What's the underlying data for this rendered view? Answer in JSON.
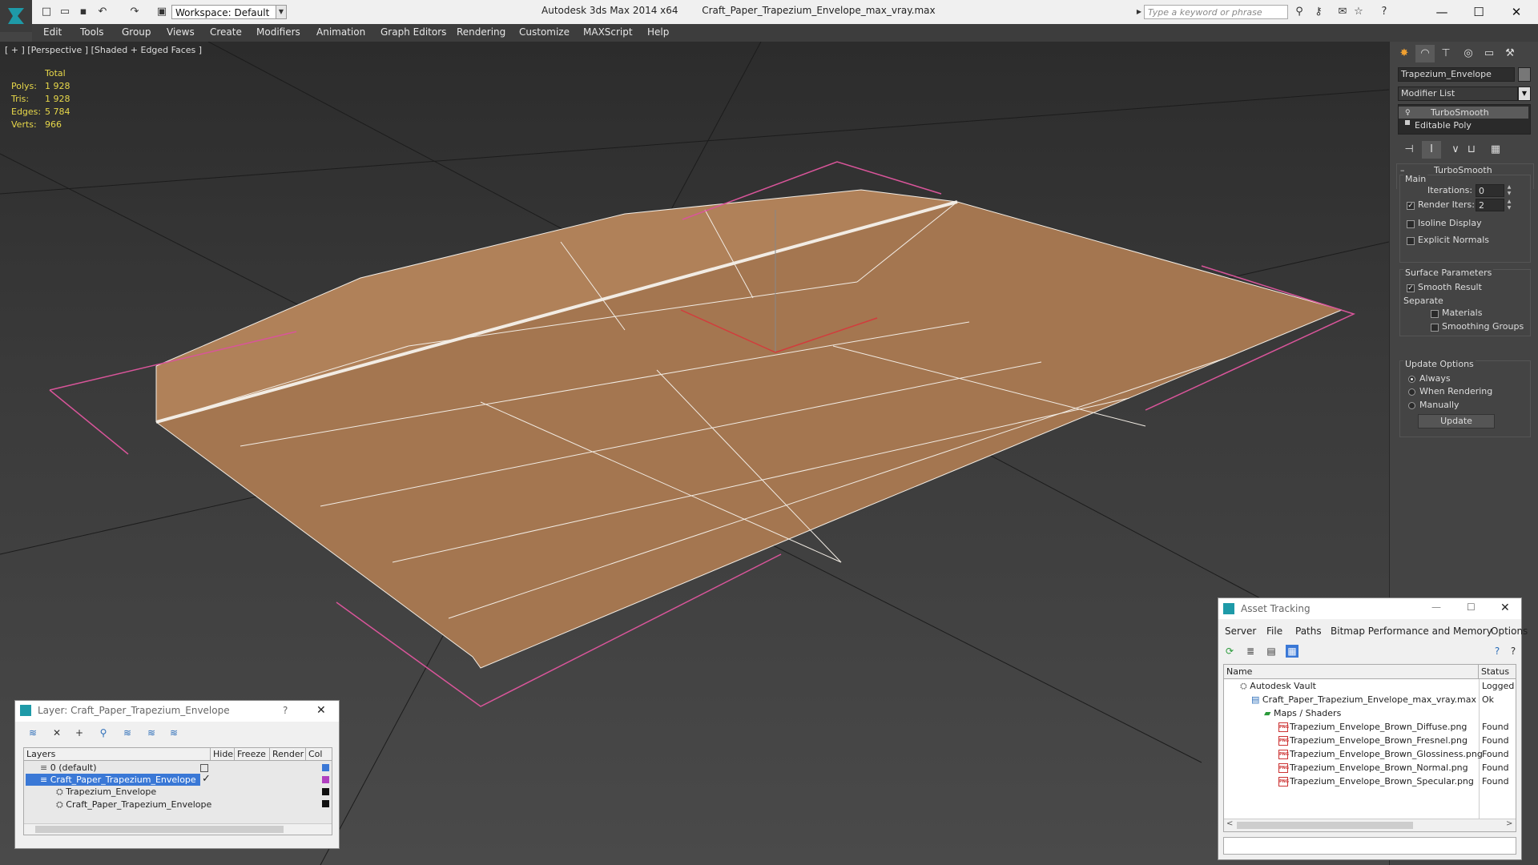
{
  "app": {
    "title": "Autodesk 3ds Max  2014 x64",
    "file": "Craft_Paper_Trapezium_Envelope_max_vray.max",
    "workspace": "Workspace: Default",
    "search_placeholder": "Type a keyword or phrase"
  },
  "menu": [
    "Edit",
    "Tools",
    "Group",
    "Views",
    "Create",
    "Modifiers",
    "Animation",
    "Graph Editors",
    "Rendering",
    "Customize",
    "MAXScript",
    "Help"
  ],
  "viewport": {
    "label": "[ + ] [Perspective ] [Shaded + Edged Faces ]",
    "stats": {
      "header": "Total",
      "rows": [
        {
          "k": "Polys:",
          "v": "1 928"
        },
        {
          "k": "Tris:",
          "v": "1 928"
        },
        {
          "k": "Edges:",
          "v": "5 784"
        },
        {
          "k": "Verts:",
          "v": "966"
        }
      ]
    }
  },
  "command_panel": {
    "object_name": "Trapezium_Envelope",
    "modifier_list": "Modifier List",
    "stack": [
      "TurboSmooth",
      "Editable Poly"
    ],
    "rollout_title": "TurboSmooth",
    "main_label": "Main",
    "iterations_label": "Iterations:",
    "iterations_value": "0",
    "render_iters_label": "Render Iters:",
    "render_iters_value": "2",
    "isoline": "Isoline Display",
    "explicit_normals": "Explicit Normals",
    "surface_params": "Surface Parameters",
    "smooth_result": "Smooth Result",
    "separate": "Separate",
    "materials": "Materials",
    "smoothing_groups": "Smoothing Groups",
    "update_options": "Update Options",
    "always": "Always",
    "when_rendering": "When Rendering",
    "manually": "Manually",
    "update_button": "Update"
  },
  "layer_window": {
    "title": "Layer: Craft_Paper_Trapezium_Envelope",
    "help": "?",
    "columns": [
      "Layers",
      "Hide",
      "Freeze",
      "Render",
      "Col"
    ],
    "rows": [
      {
        "name": "0 (default)"
      },
      {
        "name": "Craft_Paper_Trapezium_Envelope"
      },
      {
        "name": "Trapezium_Envelope"
      },
      {
        "name": "Craft_Paper_Trapezium_Envelope"
      }
    ]
  },
  "asset_window": {
    "title": "Asset Tracking",
    "menu": [
      "Server",
      "File",
      "Paths",
      "Bitmap Performance and Memory",
      "Options"
    ],
    "columns": [
      "Name",
      "Status"
    ],
    "rows": [
      {
        "name": "Autodesk Vault",
        "status": "Logged O"
      },
      {
        "name": "Craft_Paper_Trapezium_Envelope_max_vray.max",
        "status": "Ok"
      },
      {
        "name": "Maps / Shaders",
        "status": ""
      },
      {
        "name": "Trapezium_Envelope_Brown_Diffuse.png",
        "status": "Found"
      },
      {
        "name": "Trapezium_Envelope_Brown_Fresnel.png",
        "status": "Found"
      },
      {
        "name": "Trapezium_Envelope_Brown_Glossiness.png",
        "status": "Found"
      },
      {
        "name": "Trapezium_Envelope_Brown_Normal.png",
        "status": "Found"
      },
      {
        "name": "Trapezium_Envelope_Brown_Specular.png",
        "status": "Found"
      }
    ]
  },
  "colors": {
    "selection": "#3a78d6",
    "envelope": "#a47650",
    "stats": "#e8d84a"
  }
}
